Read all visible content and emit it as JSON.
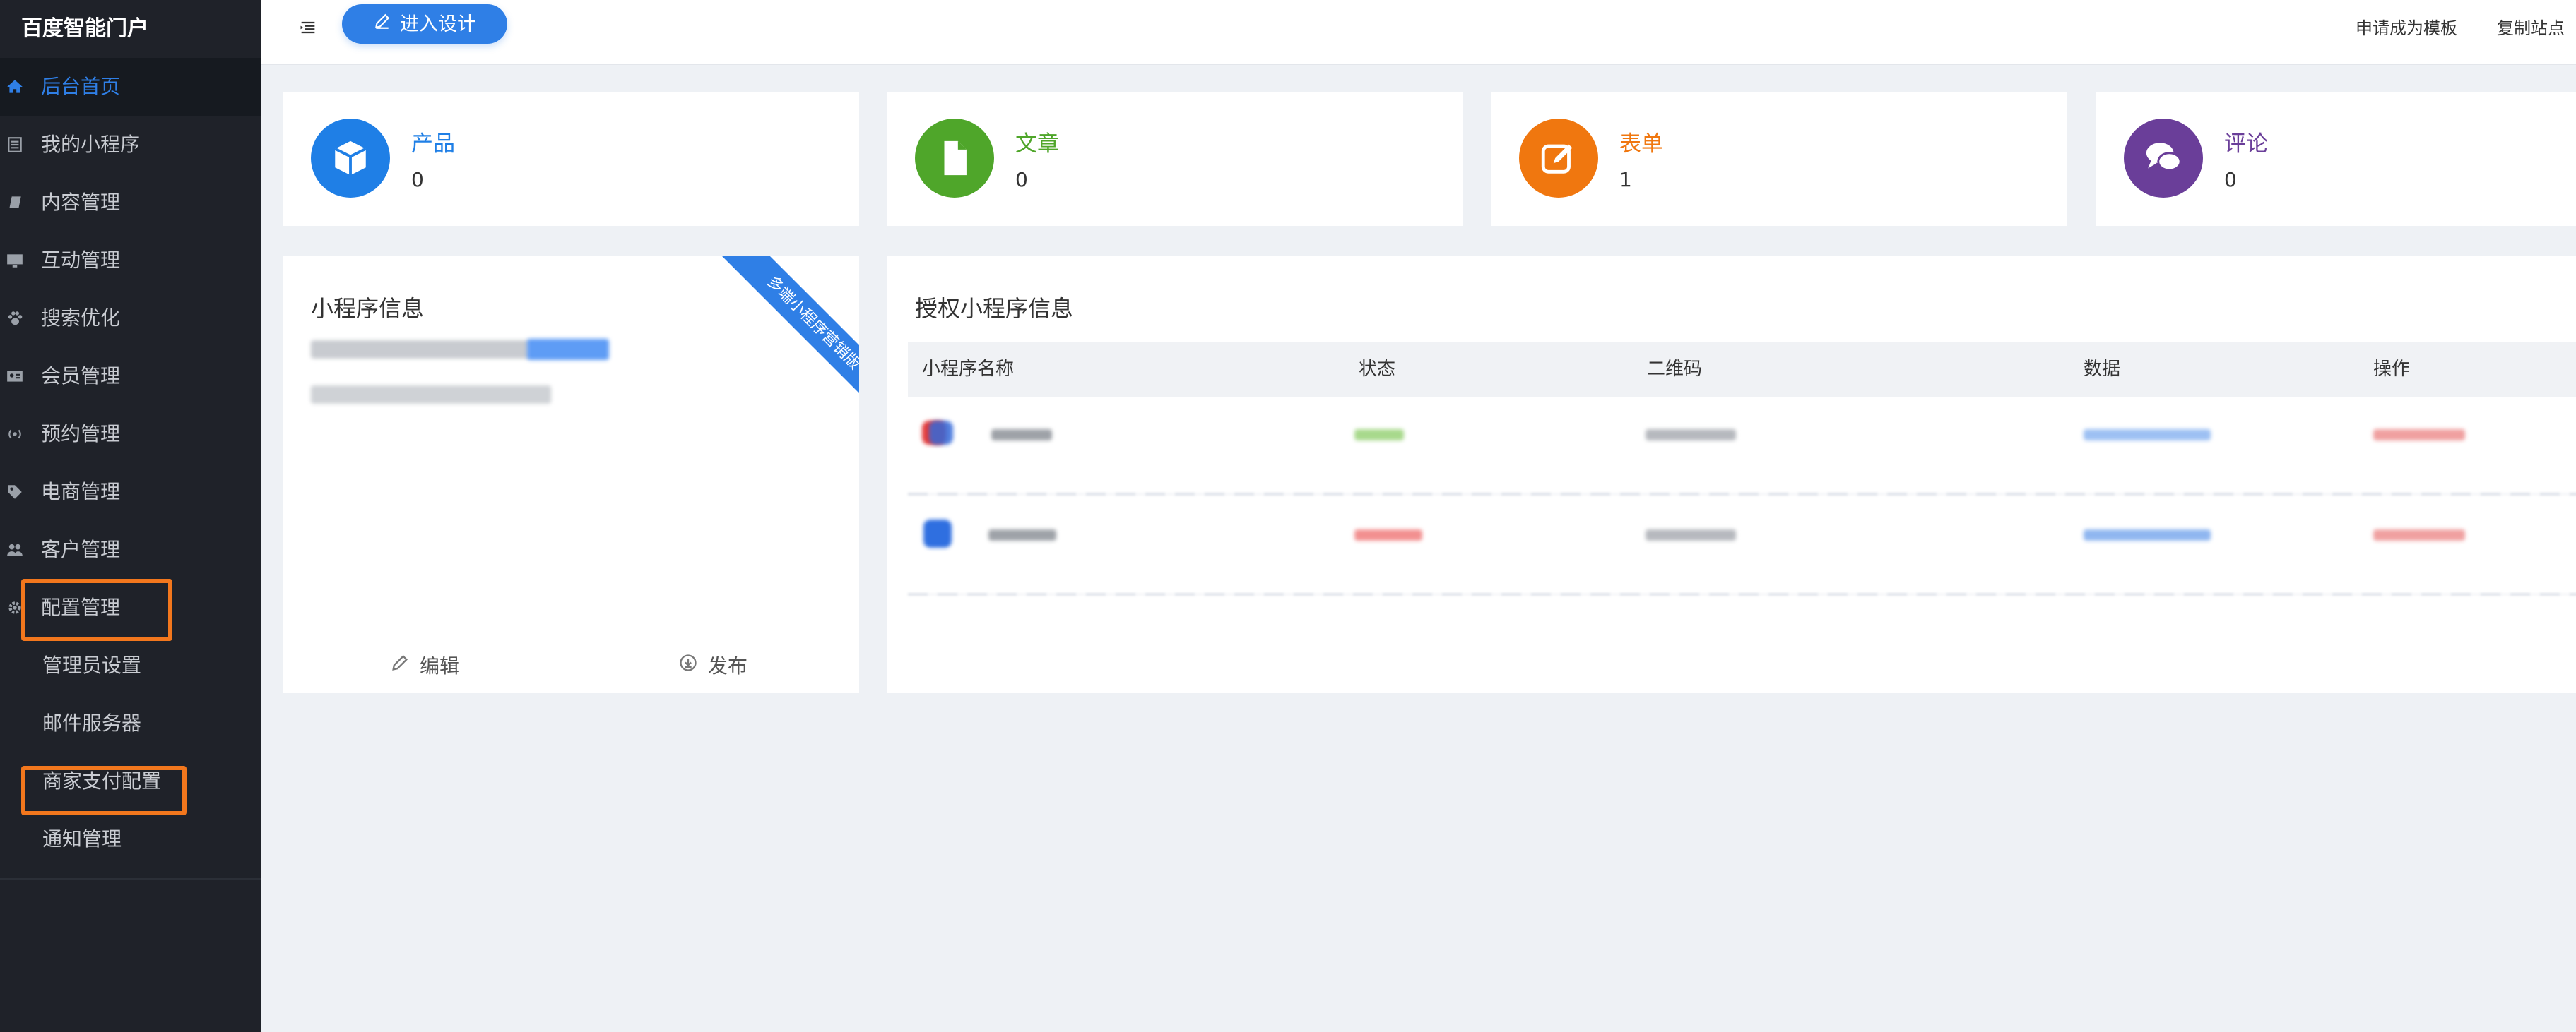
{
  "sidebar": {
    "brand": "百度智能门户",
    "items": [
      {
        "label": "后台首页",
        "icon": "home-icon",
        "active": true
      },
      {
        "label": "我的小程序",
        "icon": "list-icon"
      },
      {
        "label": "内容管理",
        "icon": "book-icon"
      },
      {
        "label": "互动管理",
        "icon": "monitor-icon"
      },
      {
        "label": "搜索优化",
        "icon": "paw-icon"
      },
      {
        "label": "会员管理",
        "icon": "id-card-icon"
      },
      {
        "label": "预约管理",
        "icon": "broadcast-icon"
      },
      {
        "label": "电商管理",
        "icon": "tag-icon"
      },
      {
        "label": "客户管理",
        "icon": "users-icon"
      },
      {
        "label": "配置管理",
        "icon": "gear-icon",
        "highlighted": true
      },
      {
        "label": "管理员设置",
        "sub": true
      },
      {
        "label": "邮件服务器",
        "sub": true
      },
      {
        "label": "商家支付配置",
        "sub": true,
        "highlighted": true
      },
      {
        "label": "通知管理",
        "sub": true
      }
    ]
  },
  "topbar": {
    "design_button": "进入设计",
    "apply_template": "申请成为模板",
    "copy_site": "复制站点"
  },
  "stats": [
    {
      "label": "产品",
      "value": "0",
      "color": "#1f7fe6",
      "icon": "cube-icon"
    },
    {
      "label": "文章",
      "value": "0",
      "color": "#4fa62a",
      "icon": "document-icon"
    },
    {
      "label": "表单",
      "value": "1",
      "color": "#f0770f",
      "icon": "edit-icon"
    },
    {
      "label": "评论",
      "value": "0",
      "color": "#6a3e99",
      "icon": "comments-icon"
    }
  ],
  "mini_info": {
    "title": "小程序信息",
    "ribbon": "多端小程序营销版",
    "edit": "编辑",
    "publish": "发布"
  },
  "auth_info": {
    "title": "授权小程序信息",
    "columns": [
      "小程序名称",
      "状态",
      "二维码",
      "数据",
      "操作"
    ]
  },
  "colors": {
    "sidebar_bg": "#1f2229",
    "accent": "#2f7fe6",
    "highlight_border": "#f2771d"
  }
}
